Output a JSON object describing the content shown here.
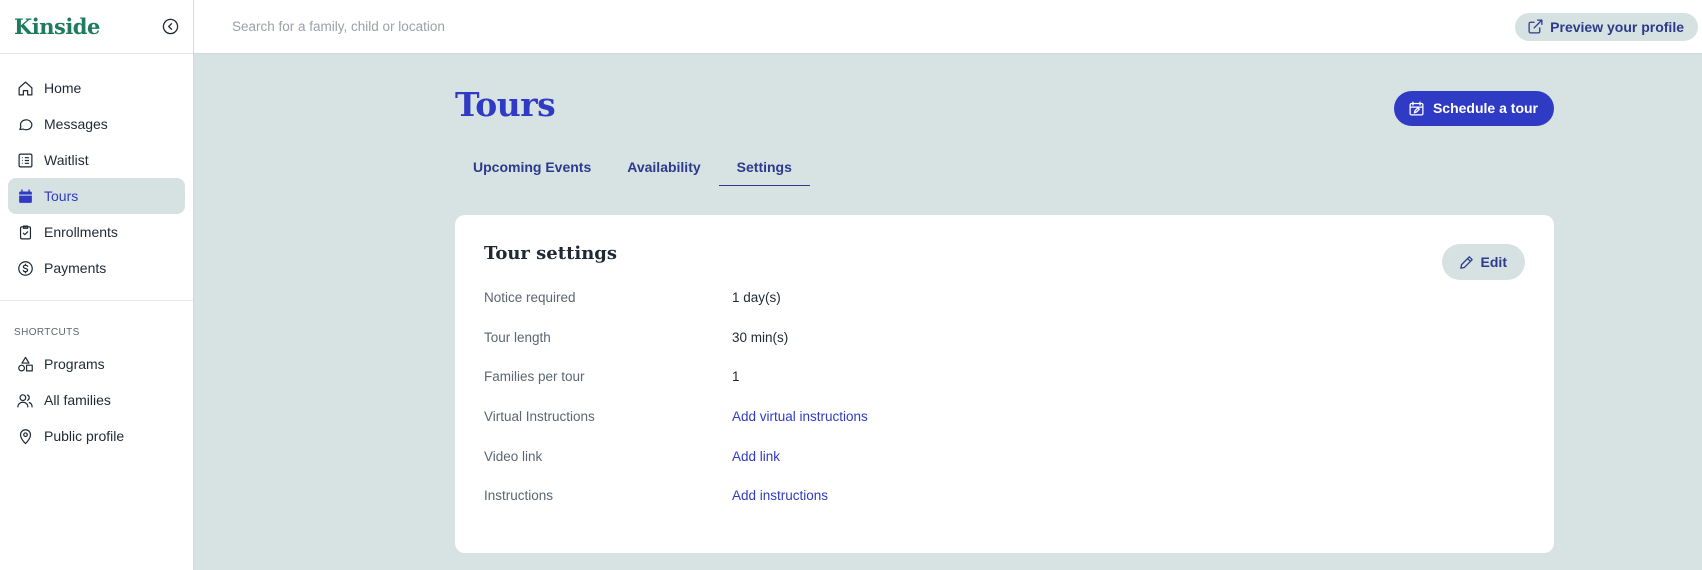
{
  "app": {
    "name": "Kinside"
  },
  "search": {
    "placeholder": "Search for a family, child or location"
  },
  "header": {
    "preview_label": "Preview your profile"
  },
  "nav": {
    "items": [
      {
        "id": "home",
        "label": "Home",
        "icon": "home-icon"
      },
      {
        "id": "messages",
        "label": "Messages",
        "icon": "chat-bubble-icon"
      },
      {
        "id": "waitlist",
        "label": "Waitlist",
        "icon": "list-icon"
      },
      {
        "id": "tours",
        "label": "Tours",
        "icon": "calendar-icon",
        "active": true
      },
      {
        "id": "enrollments",
        "label": "Enrollments",
        "icon": "clipboard-check-icon"
      },
      {
        "id": "payments",
        "label": "Payments",
        "icon": "dollar-circle-icon"
      }
    ],
    "shortcuts_label": "SHORTCUTS",
    "shortcuts": [
      {
        "id": "programs",
        "label": "Programs",
        "icon": "shapes-icon"
      },
      {
        "id": "all-families",
        "label": "All families",
        "icon": "users-icon"
      },
      {
        "id": "public-profile",
        "label": "Public profile",
        "icon": "map-pin-icon"
      }
    ]
  },
  "page": {
    "title": "Tours",
    "schedule_label": "Schedule a tour",
    "tabs": [
      {
        "label": "Upcoming Events",
        "active": false
      },
      {
        "label": "Availability",
        "active": false
      },
      {
        "label": "Settings",
        "active": true
      }
    ]
  },
  "settings": {
    "title": "Tour settings",
    "edit_label": "Edit",
    "rows": [
      {
        "label": "Notice required",
        "value": "1 day(s)",
        "link": false
      },
      {
        "label": "Tour length",
        "value": "30 min(s)",
        "link": false
      },
      {
        "label": "Families per tour",
        "value": "1",
        "link": false
      },
      {
        "label": "Virtual Instructions",
        "value": "Add virtual instructions",
        "link": true
      },
      {
        "label": "Video link",
        "value": "Add link",
        "link": true
      },
      {
        "label": "Instructions",
        "value": "Add instructions",
        "link": true
      }
    ]
  },
  "colors": {
    "brand": "#1e7b5c",
    "accent": "#2f3bc4",
    "background": "#d7e3e3"
  }
}
